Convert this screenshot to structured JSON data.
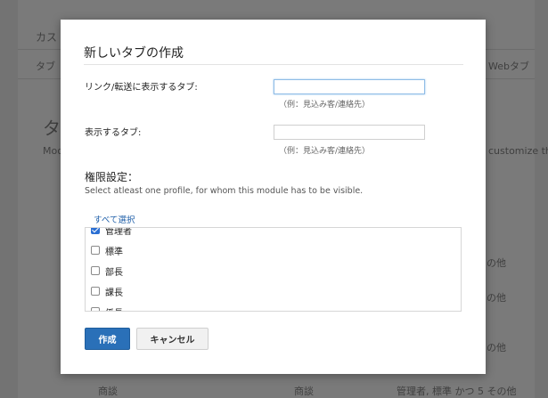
{
  "background": {
    "breadcrumb": "カス",
    "tab_label": "タブ",
    "webtab_label": "Webタブ",
    "heading": "タ",
    "desc_start": "Mod",
    "desc_end": "customize ther",
    "row_suffix": "の他",
    "bottom_left": "商談",
    "bottom_mid": "商談",
    "bottom_right": "管理者, 標準 かつ 5 その他"
  },
  "modal": {
    "title": "新しいタブの作成",
    "link_label": "リンク/転送に表示するタブ:",
    "link_value": "",
    "link_hint": "（例：見込み客/連絡先）",
    "display_label": "表示するタブ:",
    "display_value": "",
    "display_hint": "（例：見込み客/連絡先）",
    "permission_title": "権限設定：",
    "permission_desc": "Select atleast one profile, for whom this module has to be visible.",
    "select_all": "すべて選択",
    "profiles": [
      {
        "label": "管理者",
        "checked": true
      },
      {
        "label": "標準",
        "checked": false
      },
      {
        "label": "部長",
        "checked": false
      },
      {
        "label": "課長",
        "checked": false
      },
      {
        "label": "係長",
        "checked": false
      }
    ],
    "create_button": "作成",
    "cancel_button": "キャンセル"
  },
  "colors": {
    "primary": "#2a70b8",
    "link": "#1f5fa9",
    "overlay": "#737373"
  }
}
